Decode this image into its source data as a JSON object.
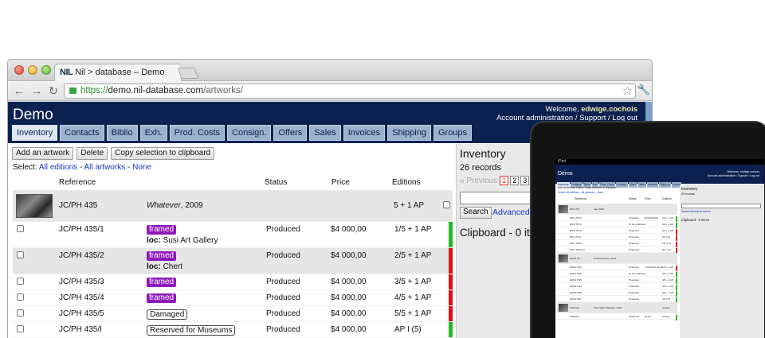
{
  "browser": {
    "tab_logo": "NIL",
    "tab_title": "Nil > database – Demo",
    "url_scheme": "https://",
    "url_host": "demo.nil-database.com",
    "url_path": "/artworks/"
  },
  "app": {
    "title": "Demo",
    "welcome_prefix": "Welcome,",
    "welcome_user": "edwige.cochois",
    "account_links": "Account administration / Support / Log out",
    "tabs": [
      "Inventory",
      "Contacts",
      "Biblio",
      "Exh.",
      "Prod. Costs",
      "Consign.",
      "Offers",
      "Sales",
      "Invoices",
      "Shipping",
      "Groups"
    ],
    "active_tab": "Inventory"
  },
  "actions": {
    "add": "Add an artwork",
    "delete": "Delete",
    "copy": "Copy selection to clipboard",
    "select_label": "Select:",
    "select_all_editions": "All editions",
    "select_all_artworks": "All artworks",
    "select_none": "None"
  },
  "table": {
    "headers": {
      "reference": "Reference",
      "status": "Status",
      "price": "Price",
      "editions": "Editions"
    },
    "group": {
      "reference": "JC/PH 435",
      "title_italic": "Whatever",
      "title_year": ", 2009",
      "editions": "5 + 1 AP"
    },
    "rows": [
      {
        "reference": "JC/PH 435/1",
        "tag": "framed",
        "tag_style": "framed",
        "loc_label": "loc:",
        "loc_value": "Susi Art Gallery",
        "status": "Produced",
        "price": "$4 000,00",
        "editions": "1/5 + 1 AP",
        "bar": "#22bb22"
      },
      {
        "reference": "JC/PH 435/2",
        "tag": "framed",
        "tag_style": "framed",
        "loc_label": "loc:",
        "loc_value": "Chert",
        "status": "Produced",
        "price": "$4 000,00",
        "editions": "2/5 + 1 AP",
        "bar": "#dd1111"
      },
      {
        "reference": "JC/PH 435/3",
        "tag": "framed",
        "tag_style": "framed",
        "status": "Produced",
        "price": "$4 000,00",
        "editions": "3/5 + 1 AP",
        "bar": "#dd1111"
      },
      {
        "reference": "JC/PH 435/4",
        "tag": "framed",
        "tag_style": "framed",
        "status": "Produced",
        "price": "$4 000,00",
        "editions": "4/5 + 1 AP",
        "bar": "#dd1111"
      },
      {
        "reference": "JC/PH 435/5",
        "tag": "Damaged",
        "tag_style": "outline",
        "status": "Produced",
        "price": "$4 000,00",
        "editions": "5/5 + 1 AP",
        "bar": "#dd1111"
      },
      {
        "reference": "JC/PH 435/I",
        "tag": "Reserved for Museums",
        "tag_style": "outline",
        "status": "Produced",
        "price": "$4 000,00",
        "editions": "AP I (5)",
        "bar": "#22bb22"
      }
    ]
  },
  "sidebar": {
    "title": "Inventory",
    "records": "26 records",
    "prev": "« Previous",
    "pages": [
      "1",
      "2",
      "3"
    ],
    "current_page": "1",
    "search_button": "Search",
    "advanced": "Advanced s",
    "clipboard": "Clipboard - 0 it"
  },
  "tablet": {
    "status": "iPad",
    "title": "Demo",
    "welcome": "Welcome, edwige.cochois",
    "account": "Account administration / Support / Log out",
    "side_title": "Inventory",
    "side_count": "26 records",
    "side_adv": "Search   Advanced search",
    "side_clip": "Clipboard - 0 items",
    "tabs": [
      "Inventory",
      "Contacts",
      "Biblio",
      "Exh.",
      "Prod. Costs",
      "Consign.",
      "Offers",
      "Sales",
      "Invoices",
      "Shipping",
      "Groups"
    ],
    "buttons": "Add an artwork   Delete   Copy selection to clipboard",
    "select": "Select: All editions - All artworks - None",
    "headers": [
      "Reference",
      "Status",
      "Price",
      "Editions"
    ],
    "rows": [
      {
        "ref": "RGS 767",
        "title": "Jas, 2000",
        "status": "",
        "price": "",
        "ed": "",
        "group": true
      },
      {
        "ref": "RGS 767/1",
        "title": "",
        "status": "Produced",
        "price": "$150 000,00",
        "ed": "1/3 + 1 AP",
        "bar": "#22bb22"
      },
      {
        "ref": "RGS 767/2",
        "title": "",
        "status": "To be produced",
        "price": "-",
        "ed": "2/3 + 1 AP",
        "bar": "#22bb22"
      },
      {
        "ref": "RGS 767/3",
        "title": "",
        "status": "Produced",
        "price": "-",
        "ed": "3/3 + 1 AP",
        "bar": "#dd1111"
      },
      {
        "ref": "RGS 767/I",
        "title": "",
        "status": "Produced",
        "price": "-",
        "ed": "AP I (3)",
        "bar": "#dd1111"
      },
      {
        "ref": "RGS 767/II",
        "title": "",
        "status": "Produced",
        "price": "-",
        "ed": "AP II (3)",
        "bar": "#dd1111"
      },
      {
        "ref": "RGS 767/HC I",
        "title": "",
        "status": "Produced",
        "price": "-",
        "ed": "HC I (3)",
        "bar": "#dd1111"
      },
      {
        "ref": "ECPH 55",
        "title": "Untitled (steel), 2010",
        "status": "",
        "price": "",
        "ed": "",
        "group": true
      },
      {
        "ref": "ECPH 55/1",
        "title": "",
        "status": "Produced",
        "price": "1 000,00 € (DKK)",
        "ed": "1/5 + 1 AP",
        "bar": "#dd1111"
      },
      {
        "ref": "ECPH 55/2",
        "title": "",
        "status": "To be produced",
        "price": "-",
        "ed": "2/5 + 1 AP",
        "bar": "#22bb22"
      },
      {
        "ref": "ECPH 55/3",
        "title": "",
        "status": "Produced",
        "price": "-",
        "ed": "3/5 + 1 AP",
        "bar": "#22bb22"
      },
      {
        "ref": "ECPH 55/4",
        "title": "",
        "status": "Produced",
        "price": "-",
        "ed": "4/5 + 1 AP",
        "bar": "#22bb22"
      },
      {
        "ref": "ECPH 55/5",
        "title": "",
        "status": "Produced",
        "price": "-",
        "ed": "5/5 + 1 AP",
        "bar": "#22bb22"
      },
      {
        "ref": "ECPH 55/I",
        "title": "",
        "status": "Produced",
        "price": "-",
        "ed": "AP I (5)",
        "bar": "#22bb22"
      },
      {
        "ref": "TSD 161",
        "title": "The Father Machine, 2004",
        "status": "",
        "price": "",
        "ed": "Unique",
        "group": true
      },
      {
        "ref": "TSD 161",
        "title": "",
        "status": "Produced",
        "price": "$0,00",
        "ed": "Unique",
        "bar": "#22bb22"
      }
    ]
  },
  "colors": {
    "header_bg": "#0b2150",
    "tab_bg": "#9bb2cc",
    "framed_tag": "#8f19bd",
    "link": "#1733c9",
    "bar_green": "#22bb22",
    "bar_red": "#dd1111"
  }
}
